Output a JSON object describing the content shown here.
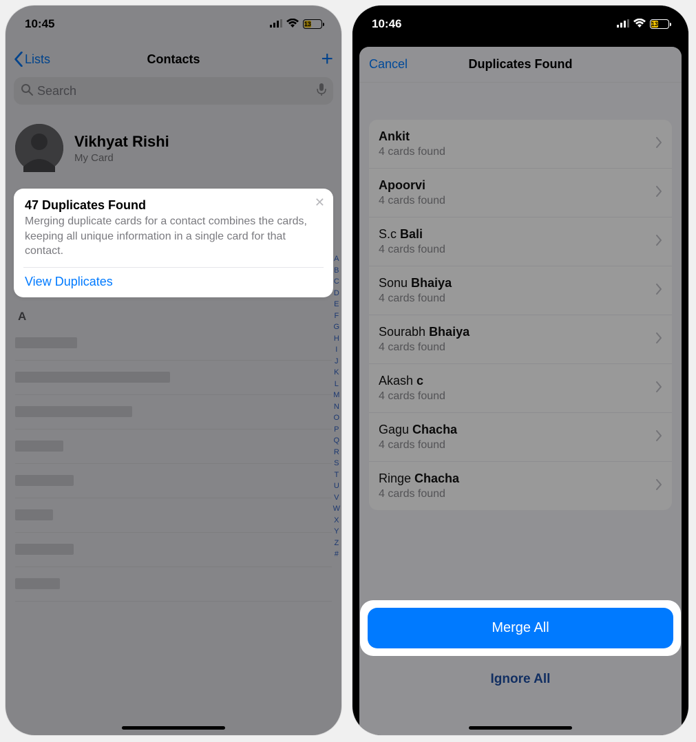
{
  "left": {
    "status": {
      "time": "10:45",
      "battery": "13"
    },
    "nav": {
      "back": "Lists",
      "title": "Contacts"
    },
    "search": {
      "placeholder": "Search"
    },
    "my_card": {
      "name": "Vikhyat Rishi",
      "sub": "My Card"
    },
    "dup_card": {
      "title": "47 Duplicates Found",
      "body": "Merging duplicate cards for a contact combines the cards, keeping all unique information in a single card for that contact.",
      "link": "View Duplicates"
    },
    "section": "A",
    "index": "ABCDEFGHIJKLMNOPQRSTUVWXYZ#"
  },
  "right": {
    "status": {
      "time": "10:46",
      "battery": "13"
    },
    "sheet": {
      "cancel": "Cancel",
      "title": "Duplicates Found"
    },
    "rows": [
      {
        "first": "Ankit",
        "last": "",
        "sub": "4 cards found"
      },
      {
        "first": "Apoorvi",
        "last": "",
        "sub": "4 cards found"
      },
      {
        "first": "S.c",
        "last": "Bali",
        "sub": "4 cards found"
      },
      {
        "first": "Sonu",
        "last": "Bhaiya",
        "sub": "4 cards found"
      },
      {
        "first": "Sourabh",
        "last": "Bhaiya",
        "sub": "4 cards found"
      },
      {
        "first": "Akash",
        "last": "c",
        "sub": "4 cards found"
      },
      {
        "first": "Gagu",
        "last": "Chacha",
        "sub": "4 cards found"
      },
      {
        "first": "Ringe",
        "last": "Chacha",
        "sub": "4 cards found"
      }
    ],
    "merge": "Merge All",
    "ignore": "Ignore All"
  }
}
